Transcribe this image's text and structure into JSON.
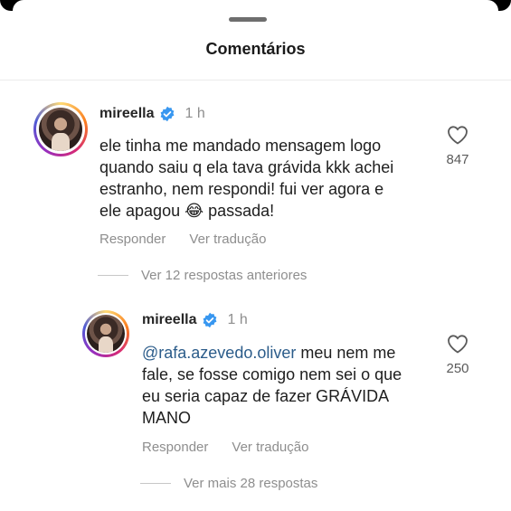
{
  "sheet": {
    "title": "Comentários"
  },
  "comments": [
    {
      "username": "mireella",
      "time": "1 h",
      "text": "ele tinha me mandado mensagem logo quando saiu q ela tava grávida kkk achei estranho, nem respondi! fui ver agora e ele apagou 😂 passada!",
      "likes": "847",
      "reply_label": "Responder",
      "translate_label": "Ver tradução",
      "more_replies": "Ver 12 respostas anteriores"
    },
    {
      "username": "mireella",
      "time": "1 h",
      "mention": "@rafa.azevedo.oliver",
      "text": " meu nem me fale, se fosse comigo nem sei o que eu seria capaz de fazer GRÁVIDA MANO",
      "likes": "250",
      "reply_label": "Responder",
      "translate_label": "Ver tradução",
      "more_replies": "Ver mais 28 respostas"
    }
  ],
  "icons": {
    "verified": "verified-badge-icon",
    "like": "heart-outline-icon"
  },
  "colors": {
    "verified": "#3897f0",
    "mention": "#2b5c8a",
    "muted": "#8e8e8e"
  }
}
